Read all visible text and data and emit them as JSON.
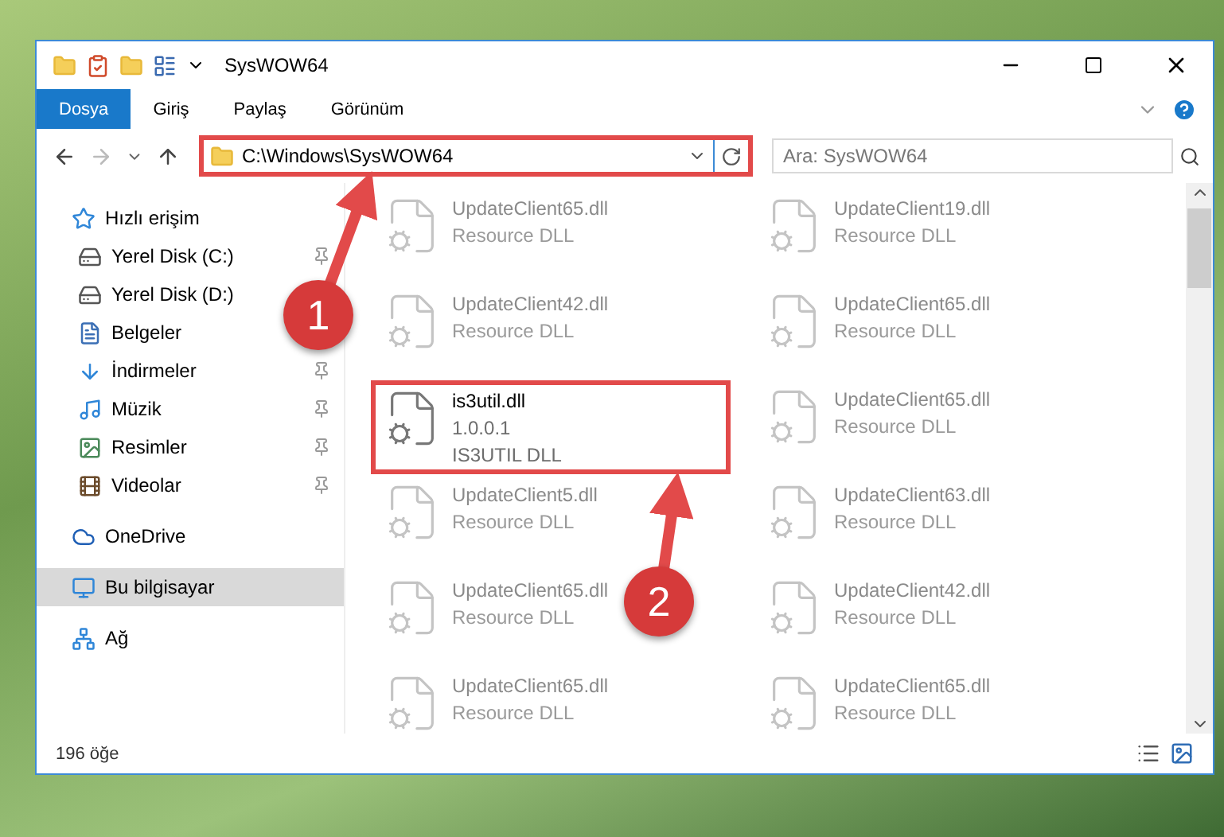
{
  "window": {
    "title": "SysWOW64"
  },
  "ribbon_tabs": [
    {
      "label": "Dosya",
      "selected": true
    },
    {
      "label": "Giriş",
      "selected": false
    },
    {
      "label": "Paylaş",
      "selected": false
    },
    {
      "label": "Görünüm",
      "selected": false
    }
  ],
  "address": {
    "path": "C:\\Windows\\SysWOW64",
    "highlighted": true
  },
  "search": {
    "placeholder": "Ara: SysWOW64"
  },
  "sidebar": [
    {
      "label": "Hızlı erişim",
      "kind": "star",
      "selected": false,
      "children": [
        {
          "label": "Yerel Disk (C:)",
          "kind": "drive",
          "pinned": true
        },
        {
          "label": "Yerel Disk (D:)",
          "kind": "drive",
          "pinned": false
        },
        {
          "label": "Belgeler",
          "kind": "doc",
          "pinned": false
        },
        {
          "label": "İndirmeler",
          "kind": "download",
          "pinned": true
        },
        {
          "label": "Müzik",
          "kind": "music",
          "pinned": true
        },
        {
          "label": "Resimler",
          "kind": "picture",
          "pinned": true
        },
        {
          "label": "Videolar",
          "kind": "video",
          "pinned": true
        }
      ]
    },
    {
      "label": "OneDrive",
      "kind": "cloud",
      "selected": false
    },
    {
      "label": "Bu bilgisayar",
      "kind": "computer",
      "selected": true
    },
    {
      "label": "Ağ",
      "kind": "network",
      "selected": false
    }
  ],
  "files": [
    {
      "name": "UpdateClient65.dll",
      "lines": [
        "Resource DLL"
      ],
      "highlighted": false
    },
    {
      "name": "UpdateClient19.dll",
      "lines": [
        "Resource DLL"
      ],
      "highlighted": false
    },
    {
      "name": "UpdateClient42.dll",
      "lines": [
        "Resource DLL"
      ],
      "highlighted": false
    },
    {
      "name": "UpdateClient65.dll",
      "lines": [
        "Resource DLL"
      ],
      "highlighted": false
    },
    {
      "name": "is3util.dll",
      "lines": [
        "1.0.0.1",
        "IS3UTIL DLL"
      ],
      "highlighted": true
    },
    {
      "name": "UpdateClient65.dll",
      "lines": [
        "Resource DLL"
      ],
      "highlighted": false
    },
    {
      "name": "UpdateClient5.dll",
      "lines": [
        "Resource DLL"
      ],
      "highlighted": false
    },
    {
      "name": "UpdateClient63.dll",
      "lines": [
        "Resource DLL"
      ],
      "highlighted": false
    },
    {
      "name": "UpdateClient65.dll",
      "lines": [
        "Resource DLL"
      ],
      "highlighted": false
    },
    {
      "name": "UpdateClient42.dll",
      "lines": [
        "Resource DLL"
      ],
      "highlighted": false
    },
    {
      "name": "UpdateClient65.dll",
      "lines": [
        "Resource DLL"
      ],
      "highlighted": false
    },
    {
      "name": "UpdateClient65.dll",
      "lines": [
        "Resource DLL"
      ],
      "highlighted": false
    }
  ],
  "status_bar": {
    "count": "196 öğe"
  },
  "annotations": [
    {
      "label": "1"
    },
    {
      "label": "2"
    }
  ]
}
